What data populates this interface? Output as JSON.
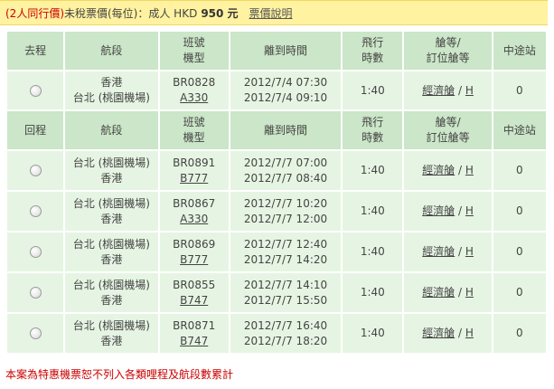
{
  "banner": {
    "group_price_label": "(2人同行價)",
    "untaxed_label": " 未稅票價(每位)：成人 HKD",
    "amount": "950 元",
    "fare_rules_link": "票價說明"
  },
  "outbound": {
    "headers": {
      "direction": "去程",
      "segment": "航段",
      "flight_line1": "班號",
      "flight_line2": "機型",
      "times": "離到時間",
      "duration_line1": "飛行",
      "duration_line2": "時數",
      "class_line1": "艙等/",
      "class_line2": "訂位艙等",
      "stops": "中途站"
    },
    "rows": [
      {
        "from": "香港",
        "to": "台北 (桃園機場)",
        "flight": "BR0828",
        "aircraft": "A330",
        "depart": "2012/7/4 07:30",
        "arrive": "2012/7/4 09:10",
        "duration": "1:40",
        "cabin": "經濟艙",
        "sep": " / ",
        "booking_class": "H",
        "stops": "0"
      }
    ]
  },
  "return": {
    "headers": {
      "direction": "回程",
      "segment": "航段",
      "flight_line1": "班號",
      "flight_line2": "機型",
      "times": "離到時間",
      "duration_line1": "飛行",
      "duration_line2": "時數",
      "class_line1": "艙等/",
      "class_line2": "訂位艙等",
      "stops": "中途站"
    },
    "rows": [
      {
        "from": "台北 (桃園機場)",
        "to": "香港",
        "flight": "BR0891",
        "aircraft": "B777",
        "depart": "2012/7/7 07:00",
        "arrive": "2012/7/7 08:40",
        "duration": "1:40",
        "cabin": "經濟艙",
        "sep": " / ",
        "booking_class": "H",
        "stops": "0"
      },
      {
        "from": "台北 (桃園機場)",
        "to": "香港",
        "flight": "BR0867",
        "aircraft": "A330",
        "depart": "2012/7/7 10:20",
        "arrive": "2012/7/7 12:00",
        "duration": "1:40",
        "cabin": "經濟艙",
        "sep": " / ",
        "booking_class": "H",
        "stops": "0"
      },
      {
        "from": "台北 (桃園機場)",
        "to": "香港",
        "flight": "BR0869",
        "aircraft": "B777",
        "depart": "2012/7/7 12:40",
        "arrive": "2012/7/7 14:20",
        "duration": "1:40",
        "cabin": "經濟艙",
        "sep": " / ",
        "booking_class": "H",
        "stops": "0"
      },
      {
        "from": "台北 (桃園機場)",
        "to": "香港",
        "flight": "BR0855",
        "aircraft": "B747",
        "depart": "2012/7/7 14:10",
        "arrive": "2012/7/7 15:50",
        "duration": "1:40",
        "cabin": "經濟艙",
        "sep": " / ",
        "booking_class": "H",
        "stops": "0"
      },
      {
        "from": "台北 (桃園機場)",
        "to": "香港",
        "flight": "BR0871",
        "aircraft": "B747",
        "depart": "2012/7/7 16:40",
        "arrive": "2012/7/7 18:20",
        "duration": "1:40",
        "cabin": "經濟艙",
        "sep": " / ",
        "booking_class": "H",
        "stops": "0"
      }
    ]
  },
  "footnote": "本案為特惠機票恕不列入各類哩程及航段數累計",
  "colors": {
    "banner_bg": "#fff2a0",
    "header_bg": "#cbe6c8",
    "row_bg": "#e6f5e3",
    "alert_red": "#cc0000"
  }
}
